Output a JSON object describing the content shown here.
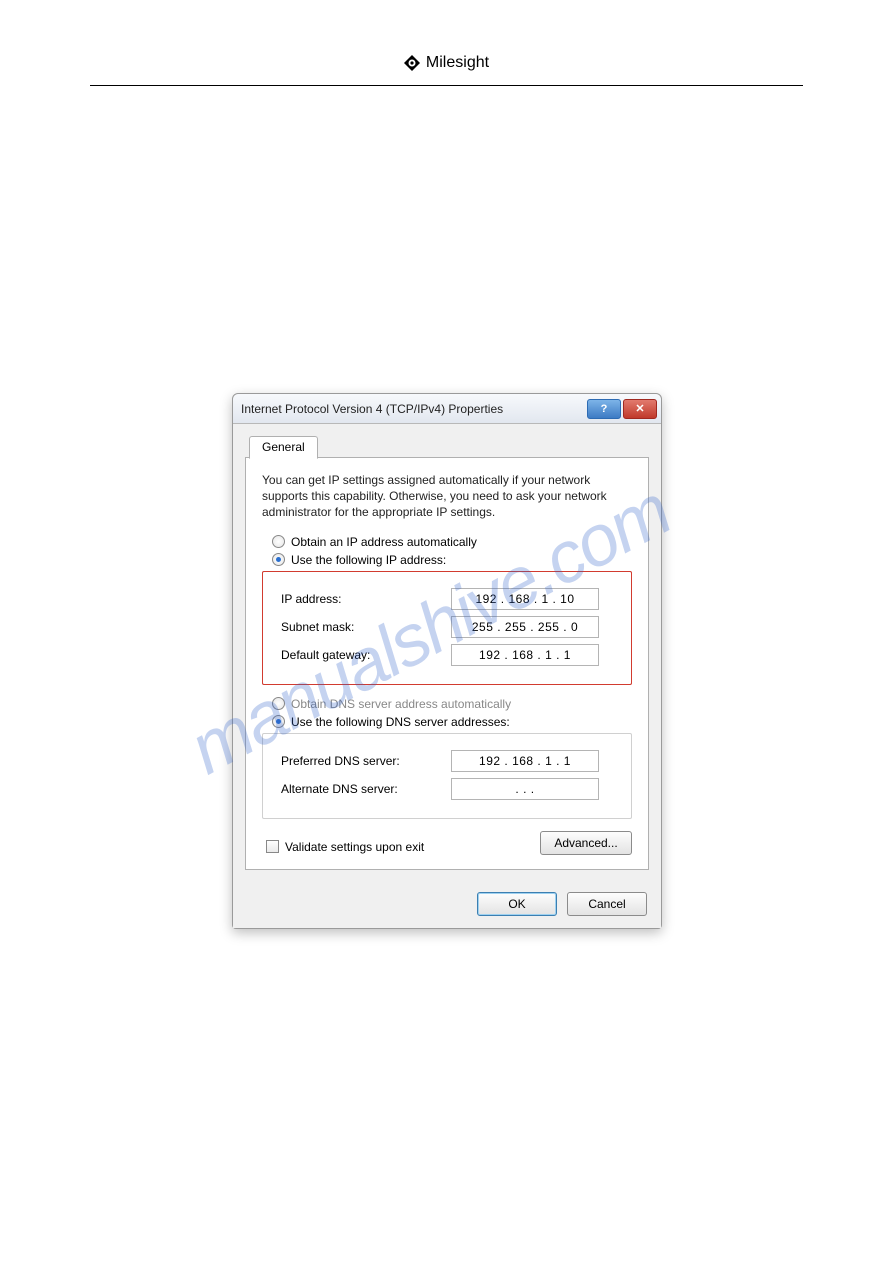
{
  "header": {
    "brand": "Milesight"
  },
  "watermark": "manualshive.com",
  "dialog": {
    "title": "Internet Protocol Version 4 (TCP/IPv4) Properties",
    "help_symbol": "?",
    "close_symbol": "✕",
    "tabs": {
      "general": "General"
    },
    "description": "You can get IP settings assigned automatically if your network supports this capability. Otherwise, you need to ask your network administrator for the appropriate IP settings.",
    "ip_radio_auto": "Obtain an IP address automatically",
    "ip_radio_manual": "Use the following IP address:",
    "ip_fields": {
      "ip_label": "IP address:",
      "ip_value": "192 . 168 .  1  . 10",
      "subnet_label": "Subnet mask:",
      "subnet_value": "255 . 255 . 255 .  0",
      "gateway_label": "Default gateway:",
      "gateway_value": "192 . 168 .  1  .  1"
    },
    "dns_radio_auto": "Obtain DNS server address automatically",
    "dns_radio_manual": "Use the following DNS server addresses:",
    "dns_fields": {
      "pref_label": "Preferred DNS server:",
      "pref_value": "192 . 168 .  1  .  1",
      "alt_label": "Alternate DNS server:",
      "alt_value": ".       .       ."
    },
    "validate_label": "Validate settings upon exit",
    "advanced_label": "Advanced...",
    "ok_label": "OK",
    "cancel_label": "Cancel"
  }
}
